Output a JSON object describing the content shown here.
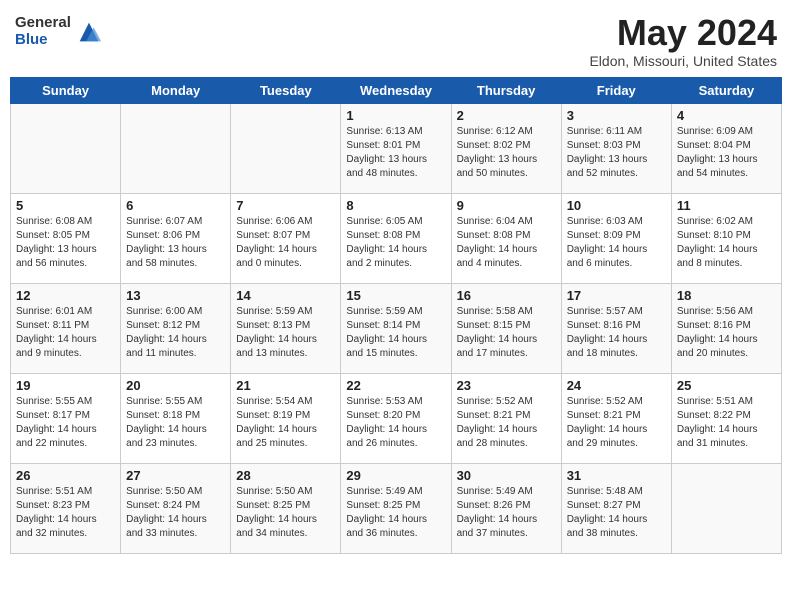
{
  "header": {
    "logo": {
      "general": "General",
      "blue": "Blue"
    },
    "title": "May 2024",
    "subtitle": "Eldon, Missouri, United States"
  },
  "weekdays": [
    "Sunday",
    "Monday",
    "Tuesday",
    "Wednesday",
    "Thursday",
    "Friday",
    "Saturday"
  ],
  "weeks": [
    [
      null,
      null,
      null,
      {
        "day": 1,
        "sunrise": "6:13 AM",
        "sunset": "8:01 PM",
        "daylight": "13 hours and 48 minutes."
      },
      {
        "day": 2,
        "sunrise": "6:12 AM",
        "sunset": "8:02 PM",
        "daylight": "13 hours and 50 minutes."
      },
      {
        "day": 3,
        "sunrise": "6:11 AM",
        "sunset": "8:03 PM",
        "daylight": "13 hours and 52 minutes."
      },
      {
        "day": 4,
        "sunrise": "6:09 AM",
        "sunset": "8:04 PM",
        "daylight": "13 hours and 54 minutes."
      }
    ],
    [
      {
        "day": 5,
        "sunrise": "6:08 AM",
        "sunset": "8:05 PM",
        "daylight": "13 hours and 56 minutes."
      },
      {
        "day": 6,
        "sunrise": "6:07 AM",
        "sunset": "8:06 PM",
        "daylight": "13 hours and 58 minutes."
      },
      {
        "day": 7,
        "sunrise": "6:06 AM",
        "sunset": "8:07 PM",
        "daylight": "14 hours and 0 minutes."
      },
      {
        "day": 8,
        "sunrise": "6:05 AM",
        "sunset": "8:08 PM",
        "daylight": "14 hours and 2 minutes."
      },
      {
        "day": 9,
        "sunrise": "6:04 AM",
        "sunset": "8:08 PM",
        "daylight": "14 hours and 4 minutes."
      },
      {
        "day": 10,
        "sunrise": "6:03 AM",
        "sunset": "8:09 PM",
        "daylight": "14 hours and 6 minutes."
      },
      {
        "day": 11,
        "sunrise": "6:02 AM",
        "sunset": "8:10 PM",
        "daylight": "14 hours and 8 minutes."
      }
    ],
    [
      {
        "day": 12,
        "sunrise": "6:01 AM",
        "sunset": "8:11 PM",
        "daylight": "14 hours and 9 minutes."
      },
      {
        "day": 13,
        "sunrise": "6:00 AM",
        "sunset": "8:12 PM",
        "daylight": "14 hours and 11 minutes."
      },
      {
        "day": 14,
        "sunrise": "5:59 AM",
        "sunset": "8:13 PM",
        "daylight": "14 hours and 13 minutes."
      },
      {
        "day": 15,
        "sunrise": "5:59 AM",
        "sunset": "8:14 PM",
        "daylight": "14 hours and 15 minutes."
      },
      {
        "day": 16,
        "sunrise": "5:58 AM",
        "sunset": "8:15 PM",
        "daylight": "14 hours and 17 minutes."
      },
      {
        "day": 17,
        "sunrise": "5:57 AM",
        "sunset": "8:16 PM",
        "daylight": "14 hours and 18 minutes."
      },
      {
        "day": 18,
        "sunrise": "5:56 AM",
        "sunset": "8:16 PM",
        "daylight": "14 hours and 20 minutes."
      }
    ],
    [
      {
        "day": 19,
        "sunrise": "5:55 AM",
        "sunset": "8:17 PM",
        "daylight": "14 hours and 22 minutes."
      },
      {
        "day": 20,
        "sunrise": "5:55 AM",
        "sunset": "8:18 PM",
        "daylight": "14 hours and 23 minutes."
      },
      {
        "day": 21,
        "sunrise": "5:54 AM",
        "sunset": "8:19 PM",
        "daylight": "14 hours and 25 minutes."
      },
      {
        "day": 22,
        "sunrise": "5:53 AM",
        "sunset": "8:20 PM",
        "daylight": "14 hours and 26 minutes."
      },
      {
        "day": 23,
        "sunrise": "5:52 AM",
        "sunset": "8:21 PM",
        "daylight": "14 hours and 28 minutes."
      },
      {
        "day": 24,
        "sunrise": "5:52 AM",
        "sunset": "8:21 PM",
        "daylight": "14 hours and 29 minutes."
      },
      {
        "day": 25,
        "sunrise": "5:51 AM",
        "sunset": "8:22 PM",
        "daylight": "14 hours and 31 minutes."
      }
    ],
    [
      {
        "day": 26,
        "sunrise": "5:51 AM",
        "sunset": "8:23 PM",
        "daylight": "14 hours and 32 minutes."
      },
      {
        "day": 27,
        "sunrise": "5:50 AM",
        "sunset": "8:24 PM",
        "daylight": "14 hours and 33 minutes."
      },
      {
        "day": 28,
        "sunrise": "5:50 AM",
        "sunset": "8:25 PM",
        "daylight": "14 hours and 34 minutes."
      },
      {
        "day": 29,
        "sunrise": "5:49 AM",
        "sunset": "8:25 PM",
        "daylight": "14 hours and 36 minutes."
      },
      {
        "day": 30,
        "sunrise": "5:49 AM",
        "sunset": "8:26 PM",
        "daylight": "14 hours and 37 minutes."
      },
      {
        "day": 31,
        "sunrise": "5:48 AM",
        "sunset": "8:27 PM",
        "daylight": "14 hours and 38 minutes."
      },
      null
    ]
  ]
}
